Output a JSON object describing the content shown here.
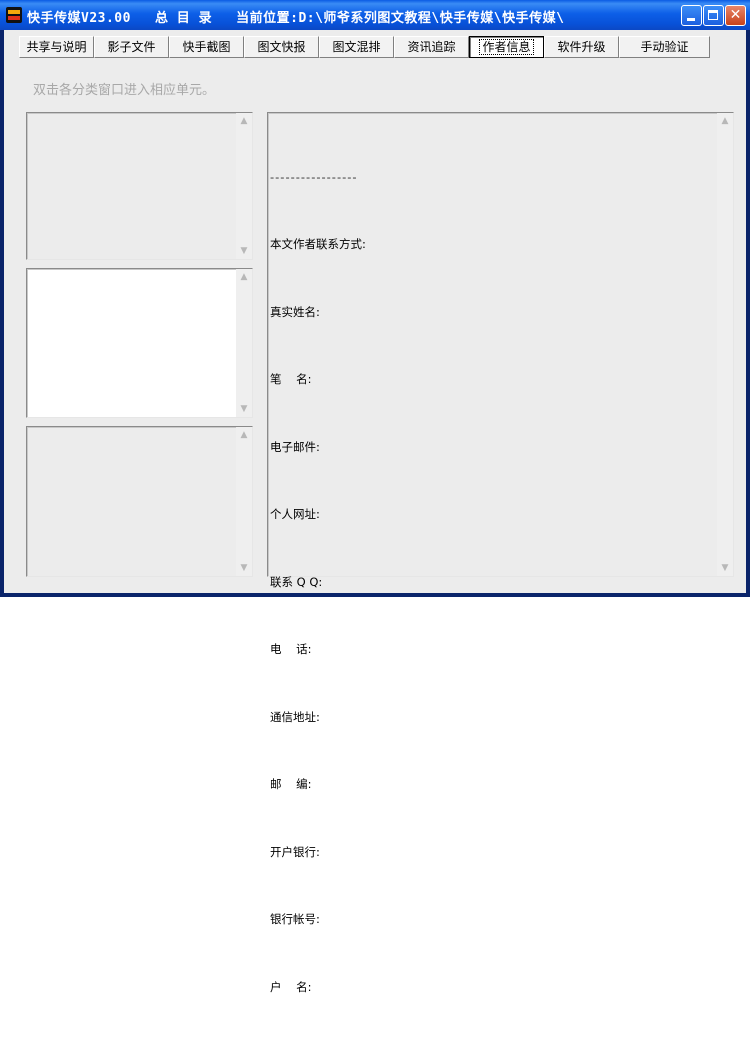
{
  "window": {
    "title_prefix": "快手传媒V23.00",
    "title_section": "总 目 录",
    "title_location_label": "当前位置:",
    "title_location_path": "D:\\师爷系列图文教程\\快手传媒\\快手传媒\\"
  },
  "tabs": [
    {
      "label": "共享与说明"
    },
    {
      "label": "影子文件"
    },
    {
      "label": "快手截图"
    },
    {
      "label": "图文快报"
    },
    {
      "label": "图文混排"
    },
    {
      "label": "资讯追踪"
    },
    {
      "label": "作者信息",
      "active": true
    },
    {
      "label": "软件升级"
    },
    {
      "label": "手动验证"
    }
  ],
  "hint": "双击各分类窗口进入相应单元。",
  "content": {
    "divider": "-----------------",
    "heading": "本文作者联系方式:",
    "fields": [
      "真实姓名:",
      "笔    名:",
      "电子邮件:",
      "个人网址:",
      "联系 Q Q:",
      "电    话:",
      "通信地址:",
      "邮    编:",
      "开户银行:",
      "银行帐号:",
      "户    名:"
    ]
  },
  "icons": {
    "app": "app-logo-icon",
    "minimize": "minimize-icon",
    "maximize": "maximize-icon",
    "close": "close-icon"
  },
  "colors": {
    "titlebar": "#0b55dc",
    "client_bg": "#ececec",
    "hint_text": "#a8a8a8"
  }
}
